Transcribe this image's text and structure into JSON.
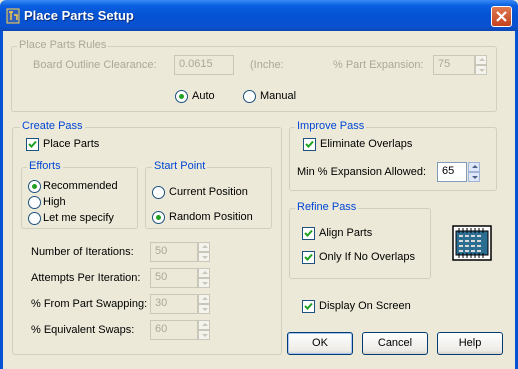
{
  "window": {
    "title": "Place Parts Setup"
  },
  "rules": {
    "group_label": "Place Parts Rules",
    "clearance_label": "Board Outline Clearance:",
    "clearance_value": "0.0615",
    "units": "(Inche:",
    "expansion_label": "% Part Expansion:",
    "expansion_value": "75",
    "auto_label": "Auto",
    "manual_label": "Manual",
    "mode_selected": "Auto"
  },
  "create_pass": {
    "group_label": "Create Pass",
    "place_parts_label": "Place Parts",
    "place_parts_checked": true,
    "efforts": {
      "group_label": "Efforts",
      "options": [
        "Recommended",
        "High",
        "Let me specify"
      ],
      "selected": "Recommended"
    },
    "start_point": {
      "group_label": "Start Point",
      "options": [
        "Current Position",
        "Random Position"
      ],
      "selected": "Random Position"
    },
    "fields": [
      {
        "label": "Number of Iterations:",
        "value": "50"
      },
      {
        "label": "Attempts Per Iteration:",
        "value": "50"
      },
      {
        "label": "% From Part Swapping:",
        "value": "30"
      },
      {
        "label": "% Equivalent Swaps:",
        "value": "60"
      }
    ]
  },
  "improve_pass": {
    "group_label": "Improve Pass",
    "eliminate_label": "Eliminate Overlaps",
    "eliminate_checked": true,
    "min_expansion_label": "Min % Expansion Allowed:",
    "min_expansion_value": "65"
  },
  "refine_pass": {
    "group_label": "Refine Pass",
    "align_label": "Align Parts",
    "align_checked": true,
    "only_if_label": "Only If No Overlaps",
    "only_if_checked": true
  },
  "display_on_screen_label": "Display On Screen",
  "display_on_screen_checked": true,
  "buttons": {
    "ok": "OK",
    "cancel": "Cancel",
    "help": "Help"
  },
  "colors": {
    "title_bar": "#0453d4",
    "group_label": "#0046d5",
    "close_button": "#c2421e",
    "check_mark": "#21a121"
  },
  "icons": {
    "app": "pcb-app-icon",
    "close": "close-icon",
    "chip": "chip-icon"
  }
}
